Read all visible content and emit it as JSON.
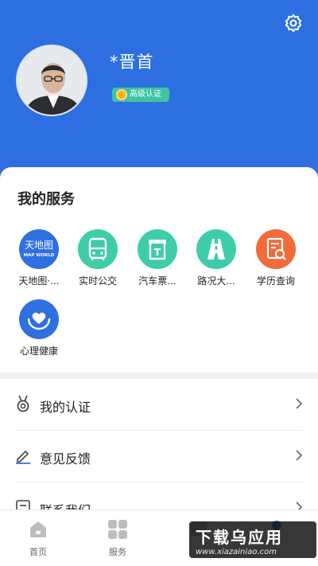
{
  "header": {
    "username": "*晋首",
    "badge": "高级认证"
  },
  "services": {
    "title": "我的服务",
    "items": [
      {
        "label": "天地图·...",
        "icon": "tianditu-logo-icon",
        "logo_text": "天地图",
        "logo_sub": "MAP WORLD",
        "color": "#2f6fe0"
      },
      {
        "label": "实时公交",
        "icon": "bus-icon",
        "color": "#3ecda9"
      },
      {
        "label": "汽车票...",
        "icon": "ticket-icon",
        "color": "#3ecda9"
      },
      {
        "label": "路况大...",
        "icon": "road-icon",
        "color": "#3ecda9"
      },
      {
        "label": "学历查询",
        "icon": "document-search-icon",
        "color": "#f26b3a"
      },
      {
        "label": "心理健康",
        "icon": "heart-hand-icon",
        "color": "#2f6fe0"
      }
    ]
  },
  "menu": [
    {
      "label": "我的认证",
      "icon": "medal-icon"
    },
    {
      "label": "意见反馈",
      "icon": "edit-icon"
    },
    {
      "label": "联系我们",
      "icon": "contact-icon"
    }
  ],
  "tabs": [
    {
      "label": "首页",
      "icon": "home-icon"
    },
    {
      "label": "服务",
      "icon": "grid-icon"
    },
    {
      "label": "",
      "icon": "message-icon"
    },
    {
      "label": "",
      "icon": "profile-icon"
    }
  ],
  "watermark": {
    "main": "下载乌应用",
    "sub": "www.xiazainiao.com"
  },
  "colors": {
    "primary": "#2d6fe0",
    "teal": "#3ecda9",
    "orange": "#f26b3a",
    "badge": "#3ec4a1"
  }
}
